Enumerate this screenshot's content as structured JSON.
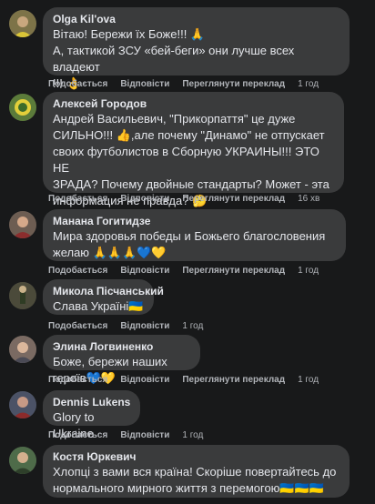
{
  "actions": {
    "like": "Подобається",
    "reply": "Відповісти",
    "translate": "Переглянути переклад"
  },
  "comments": [
    {
      "author": "Olga Kil'ova",
      "lines": [
        "Вітаю! Бережи їх Боже!!! 🙏",
        "А, тактикой ЗСУ «бей-беги» они лучше всех владеют",
        "!!! 👌"
      ],
      "time": "1 год",
      "translate": true
    },
    {
      "author": "Алексей Городов",
      "lines": [
        "Андрей Васильевич, \"Прикорпаття\" це дуже",
        "СИЛЬНО!!! 👍,але почему \"Динамо\" не отпускает",
        "своих футболистов в Сборную УКРАИНЫ!!! ЭТО НЕ",
        "ЗРАДА? Почему двойные стандарты? Может - эта",
        "информация не правда? 🤔"
      ],
      "time": "16 хв",
      "translate": true
    },
    {
      "author": "Манана Гогитидзе",
      "lines": [
        "Мира здоровья победы и Божьего благословения",
        "желаю 🙏🙏🙏💙💛"
      ],
      "time": "1 год",
      "translate": true
    },
    {
      "author": "Микола Пісчанський",
      "lines": [
        "Слава Україні🇺🇦"
      ],
      "time": "1 год",
      "translate": false
    },
    {
      "author": "Элина Логвиненко",
      "lines": [
        "Боже, бережи наших героїв💙💛"
      ],
      "time": "1 год",
      "translate": true
    },
    {
      "author": "Dennis Lukens",
      "lines": [
        "Glory to Ukraine"
      ],
      "time": "1 год",
      "translate": false
    },
    {
      "author": "Костя Юркевич",
      "lines": [
        "Хлопці з вами вся країна! Скоріше повертайтесь до",
        "нормального мирного життя з перемогою🇺🇦🇺🇦🇺🇦"
      ],
      "time": "",
      "translate": false
    }
  ],
  "avatars": [
    "#7d7348",
    "#5b7b3a",
    "#6d5d52",
    "#4b4a3a",
    "#7a6a62",
    "#4b5266",
    "#4e6b49"
  ]
}
